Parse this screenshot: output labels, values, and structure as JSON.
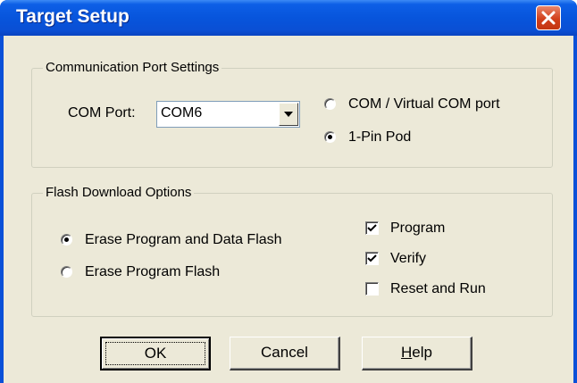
{
  "window": {
    "title": "Target Setup"
  },
  "comm_group": {
    "legend": "Communication Port Settings",
    "com_port_label": "COM Port:",
    "com_port_value": "COM6",
    "radio_options": [
      {
        "label": "COM / Virtual COM port",
        "selected": false
      },
      {
        "label": "1-Pin Pod",
        "selected": true
      }
    ]
  },
  "flash_group": {
    "legend": "Flash Download Options",
    "radio_options": [
      {
        "label": "Erase Program and Data Flash",
        "selected": true
      },
      {
        "label": "Erase Program Flash",
        "selected": false
      }
    ],
    "checkboxes": [
      {
        "label": "Program",
        "checked": true
      },
      {
        "label": "Verify",
        "checked": true
      },
      {
        "label": "Reset and Run",
        "checked": false
      }
    ]
  },
  "buttons": {
    "ok": "OK",
    "cancel": "Cancel",
    "help_mnemonic": "H",
    "help_rest": "elp"
  }
}
